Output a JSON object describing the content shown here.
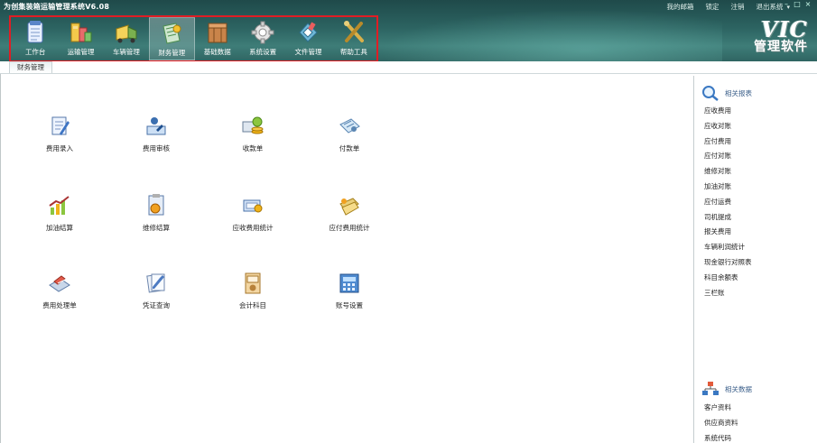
{
  "app": {
    "title": "为创集装箱运输管理系统V6.08",
    "top_links": [
      "我的邮箱",
      "锁定",
      "注销",
      "退出系统"
    ],
    "dropdown_arrow": "▾",
    "window_buttons": [
      "–",
      "□",
      "×"
    ],
    "logo_main": "VIC",
    "logo_sub": "管理软件"
  },
  "toolbar": {
    "items": [
      {
        "label": "工作台",
        "icon": "workbench-icon"
      },
      {
        "label": "运输管理",
        "icon": "transport-icon"
      },
      {
        "label": "车辆管理",
        "icon": "truck-icon"
      },
      {
        "label": "财务管理",
        "icon": "finance-icon",
        "active": true
      },
      {
        "label": "基础数据",
        "icon": "database-icon"
      },
      {
        "label": "系统设置",
        "icon": "gear-icon"
      },
      {
        "label": "文件管理",
        "icon": "file-icon"
      },
      {
        "label": "帮助工具",
        "icon": "tools-icon"
      }
    ]
  },
  "tabs": [
    {
      "label": "财务管理"
    }
  ],
  "functions": [
    {
      "label": "费用录入",
      "icon": "expense-entry-icon"
    },
    {
      "label": "费用审核",
      "icon": "expense-audit-icon"
    },
    {
      "label": "收款单",
      "icon": "receipt-icon"
    },
    {
      "label": "付款单",
      "icon": "payment-icon"
    },
    {
      "label": "加油结算",
      "icon": "fuel-settlement-icon"
    },
    {
      "label": "维修结算",
      "icon": "repair-settlement-icon"
    },
    {
      "label": "应收费用统计",
      "icon": "receivable-stats-icon"
    },
    {
      "label": "应付费用统计",
      "icon": "payable-stats-icon"
    },
    {
      "label": "费用处理单",
      "icon": "expense-process-icon"
    },
    {
      "label": "凭证查询",
      "icon": "voucher-query-icon"
    },
    {
      "label": "会计科目",
      "icon": "accounting-subject-icon"
    },
    {
      "label": "账号设置",
      "icon": "account-settings-icon"
    }
  ],
  "right_panel": {
    "reports_title": "相关报表",
    "reports": [
      "应收费用",
      "应收对账",
      "应付费用",
      "应付对账",
      "维修对账",
      "加油对账",
      "应付运费",
      "司机提成",
      "报关费用",
      "车辆利润统计",
      "现金银行对照表",
      "科目余额表",
      "三栏账"
    ],
    "data_title": "相关数据",
    "data": [
      "客户资料",
      "供应商资料",
      "系统代码"
    ]
  },
  "colors": {
    "header": "#2c6361",
    "highlight_border": "#e11d24",
    "panel_title": "#3b5f8a"
  }
}
